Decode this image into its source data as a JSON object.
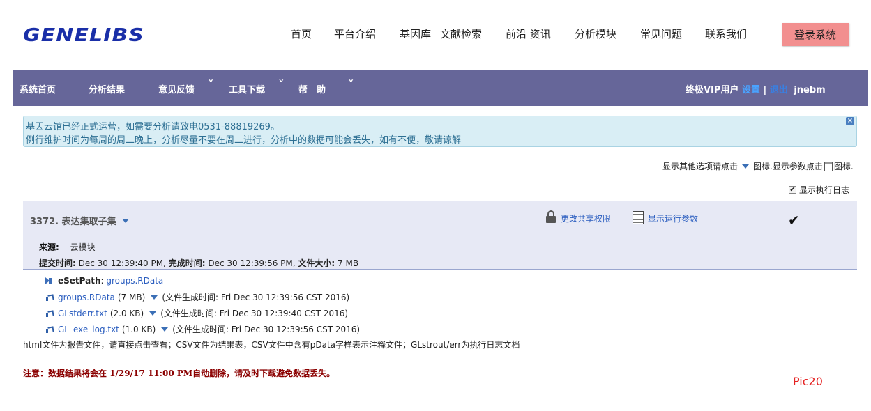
{
  "header": {
    "logo": "GENELIBS",
    "nav": [
      "首页",
      "平台介绍",
      "基因库",
      "文献检索",
      "前沿 资讯",
      "分析模块",
      "常见问题",
      "联系我们"
    ],
    "login_label": "登录系统"
  },
  "menubar": {
    "items": [
      "系统首页",
      "分析结果",
      "意见反馈",
      "工具下载",
      "帮　助"
    ],
    "user_type": "终极VIP用户",
    "settings_label": "设置",
    "logout_label": "退出",
    "username": "jnebm",
    "colors": {
      "bar": "#666699"
    }
  },
  "notice": {
    "line1": "基因云馆已经正式运营，如需要分析请致电0531-88819269。",
    "line2": "例行维护时间为每周的周二晚上，分析尽量不要在周二进行，分析中的数据可能会丢失，如有不便，敬请谅解"
  },
  "options": {
    "text1": "显示其他选项请点击",
    "text2": "图标.显示参数点击",
    "text3": "图标.",
    "show_log_label": "显示执行日志",
    "show_log_checked": true
  },
  "job": {
    "title": "3372. 表达集取子集",
    "share_label": "更改共享权限",
    "params_label": "显示运行参数",
    "status_icon": "checkmark",
    "source_label": "来源:",
    "source_value": "云模块",
    "submit_label": "提交时间:",
    "submit_value": "Dec 30 12:39:40 PM,",
    "finish_label": "完成时间:",
    "finish_value": "Dec 30 12:39:56 PM,",
    "size_label": "文件大小:",
    "size_value": "7 MB"
  },
  "files": {
    "eset_label": "eSetPath",
    "eset_value": "groups.RData",
    "items": [
      {
        "name": "groups.RData",
        "size": "(7 MB)",
        "gen": "(文件生成时间: Fri Dec 30 12:39:56 CST 2016)"
      },
      {
        "name": "GLstderr.txt",
        "size": "(2.0 KB)",
        "gen": "(文件生成时间: Fri Dec 30 12:39:40 CST 2016)"
      },
      {
        "name": "GL_exe_log.txt",
        "size": "(1.0 KB)",
        "gen": "(文件生成时间: Fri Dec 30 12:39:56 CST 2016)"
      }
    ],
    "hint": "html文件为报告文件，请直接点击查看；CSV文件为结果表，CSV文件中含有pData字样表示注释文件；GLstrout/err为执行日志文档"
  },
  "warning": "注意：数据结果将会在 1/29/17 11:00 PM自动删除，请及时下载避免数据丢失。",
  "pic_label": "Pic20"
}
